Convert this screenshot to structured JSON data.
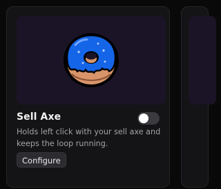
{
  "card": {
    "title": "Sell Axe",
    "description": "Holds left click with your sell axe and keeps the loop running.",
    "configure_label": "Configure",
    "toggle_enabled": false,
    "icon": "donut-icon"
  },
  "colors": {
    "page_bg": "#090909",
    "card_bg": "#141416",
    "thumb_bg": "#1b1426",
    "frosting": "#1565e8",
    "dough": "#d9956a"
  }
}
